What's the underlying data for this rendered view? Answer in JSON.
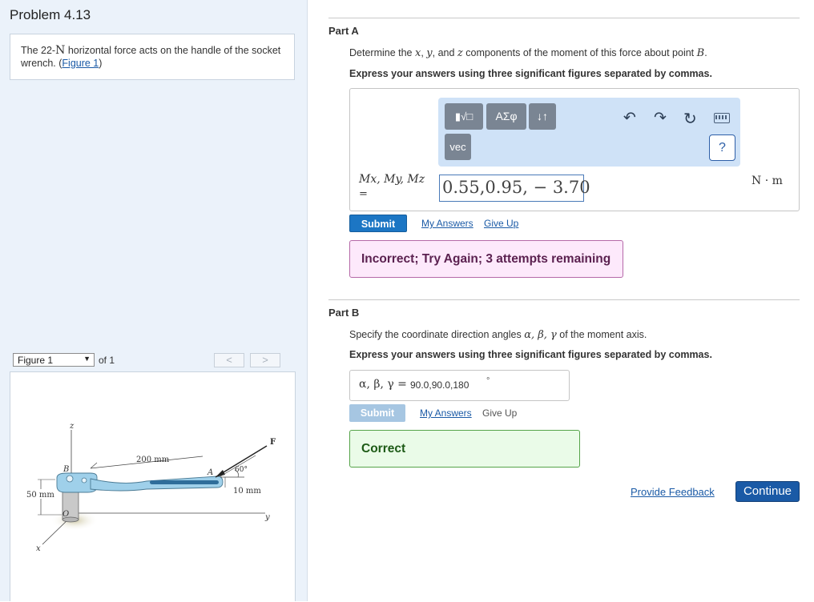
{
  "problem": {
    "title": "Problem 4.13",
    "text_pre": "The 22-",
    "text_force_unit": "N",
    "text_post": " horizontal force acts on the handle of the socket wrench. (",
    "figure_link": "Figure 1",
    "text_close": ")"
  },
  "figure_nav": {
    "selected": "Figure 1",
    "of_label": "of 1",
    "prev": "<",
    "next": ">"
  },
  "figure": {
    "label_z": "z",
    "label_x": "x",
    "label_y": "y",
    "label_B": "B",
    "label_A": "A",
    "label_O": "O",
    "label_F": "F",
    "dim_length": "200 mm",
    "dim_height": "50 mm",
    "dim_offset": "10 mm",
    "angle": "60°"
  },
  "part_a": {
    "label": "Part A",
    "prompt_pre": "Determine the ",
    "var_x": "x",
    "sep1": ", ",
    "var_y": "y",
    "sep2": ", and ",
    "var_z": "z",
    "prompt_mid": " components of the moment of this force about point ",
    "point": "B",
    "prompt_end": ".",
    "instruction": "Express your answers using three significant figures separated by commas.",
    "toolbar": {
      "templates": "▮√□",
      "greek": "AΣφ",
      "arrows": "↓↑",
      "vec": "vec",
      "help": "?"
    },
    "var_label": "Mx, My, Mz",
    "eq": "=",
    "answer": "0.55,0.95, − 3.70",
    "unit": "N · m",
    "submit": "Submit",
    "my_answers": "My Answers",
    "give_up": "Give Up",
    "feedback": "Incorrect; Try Again; 3 attempts remaining"
  },
  "part_b": {
    "label": "Part B",
    "prompt_pre": "Specify the coordinate direction angles ",
    "angles": "α, β, γ",
    "prompt_post": " of the moment axis.",
    "instruction": "Express your answers using three significant figures separated by commas.",
    "var_label": "α, β, γ =",
    "answer": "90.0,90.0,180",
    "unit": "°",
    "submit": "Submit",
    "my_answers": "My Answers",
    "give_up": "Give Up",
    "feedback": "Correct"
  },
  "footer": {
    "provide_feedback": "Provide Feedback",
    "continue": "Continue"
  },
  "colors": {
    "left_panel_bg": "#ebf2fa",
    "link": "#1a5aa6",
    "submit_active": "#1c76c4",
    "submit_disabled": "#a6c6e2",
    "toolbar_bg": "#cfe2f7",
    "incorrect_bg": "#fde9fb",
    "correct_bg": "#eafbe8",
    "wrench_blue": "#9fd0ea"
  }
}
